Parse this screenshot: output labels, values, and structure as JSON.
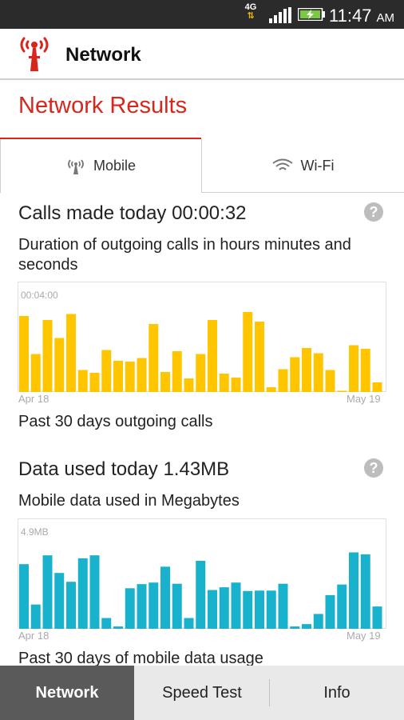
{
  "status_bar": {
    "network_type": "4G",
    "time": "11:47",
    "ampm": "AM"
  },
  "app_bar": {
    "title": "Network",
    "logo_icon": "antenna-tower-icon"
  },
  "page": {
    "title": "Network Results"
  },
  "tabs": [
    {
      "label": "Mobile",
      "icon": "cell-tower-icon",
      "selected": true
    },
    {
      "label": "Wi-Fi",
      "icon": "wifi-icon",
      "selected": false
    }
  ],
  "calls": {
    "heading": "Calls made today 00:00:32",
    "help": "?",
    "subtitle": "Duration of outgoing calls in hours minutes and seconds",
    "caption": "Past 30 days outgoing calls"
  },
  "data": {
    "heading": "Data used today 1.43MB",
    "help": "?",
    "subtitle": "Mobile data used in Megabytes",
    "caption": "Past 30 days of mobile data usage"
  },
  "chart_data": [
    {
      "type": "bar",
      "color": "#ffc600",
      "max_label": "00:04:00",
      "x_start_label": "Apr 18",
      "x_end_label": "May 19",
      "ylim": [
        0,
        240
      ],
      "unit": "seconds",
      "values": [
        190,
        95,
        180,
        135,
        195,
        55,
        48,
        105,
        78,
        76,
        85,
        170,
        50,
        102,
        34,
        95,
        180,
        46,
        36,
        200,
        176,
        12,
        57,
        87,
        110,
        97,
        55,
        3,
        117,
        108,
        24
      ]
    },
    {
      "type": "bar",
      "color": "#19b2cd",
      "max_label": "4.9MB",
      "x_start_label": "Apr 18",
      "x_end_label": "May 19",
      "ylim": [
        0,
        4.9
      ],
      "unit": "MB",
      "values": [
        3.3,
        1.24,
        3.75,
        2.85,
        2.4,
        3.6,
        3.75,
        0.55,
        0.12,
        2.07,
        2.28,
        2.36,
        3.17,
        2.3,
        0.55,
        3.47,
        1.98,
        2.12,
        2.36,
        1.93,
        1.95,
        1.95,
        2.3,
        0.12,
        0.24,
        0.76,
        1.72,
        2.26,
        3.9,
        3.8,
        1.14
      ]
    }
  ],
  "bottom_nav": [
    {
      "label": "Network",
      "selected": true
    },
    {
      "label": "Speed Test",
      "selected": false
    },
    {
      "label": "Info",
      "selected": false
    }
  ]
}
